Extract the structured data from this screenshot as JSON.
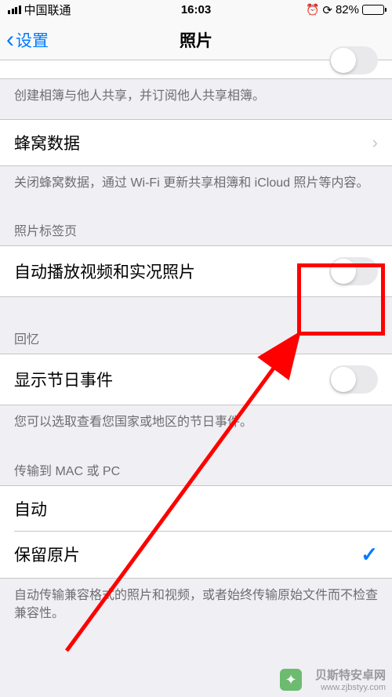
{
  "status_bar": {
    "carrier": "中国联通",
    "time": "16:03",
    "battery_pct": "82%"
  },
  "nav": {
    "back_label": "设置",
    "title": "照片"
  },
  "shared_albums": {
    "footer": "创建相簿与他人共享，并订阅他人共享相簿。"
  },
  "cellular": {
    "label": "蜂窝数据",
    "footer": "关闭蜂窝数据，通过 Wi-Fi 更新共享相簿和 iCloud 照片等内容。"
  },
  "photos_tab": {
    "header": "照片标签页",
    "autoplay_label": "自动播放视频和实况照片"
  },
  "memories": {
    "header": "回忆",
    "show_holidays_label": "显示节日事件",
    "footer": "您可以选取查看您国家或地区的节日事件。"
  },
  "transfer": {
    "header": "传输到 MAC 或 PC",
    "auto_label": "自动",
    "keep_original_label": "保留原片",
    "footer": "自动传输兼容格式的照片和视频，或者始终传输原始文件而不检查兼容性。"
  },
  "watermark": {
    "name": "贝斯特安卓网",
    "url": "www.zjbstyy.com"
  }
}
